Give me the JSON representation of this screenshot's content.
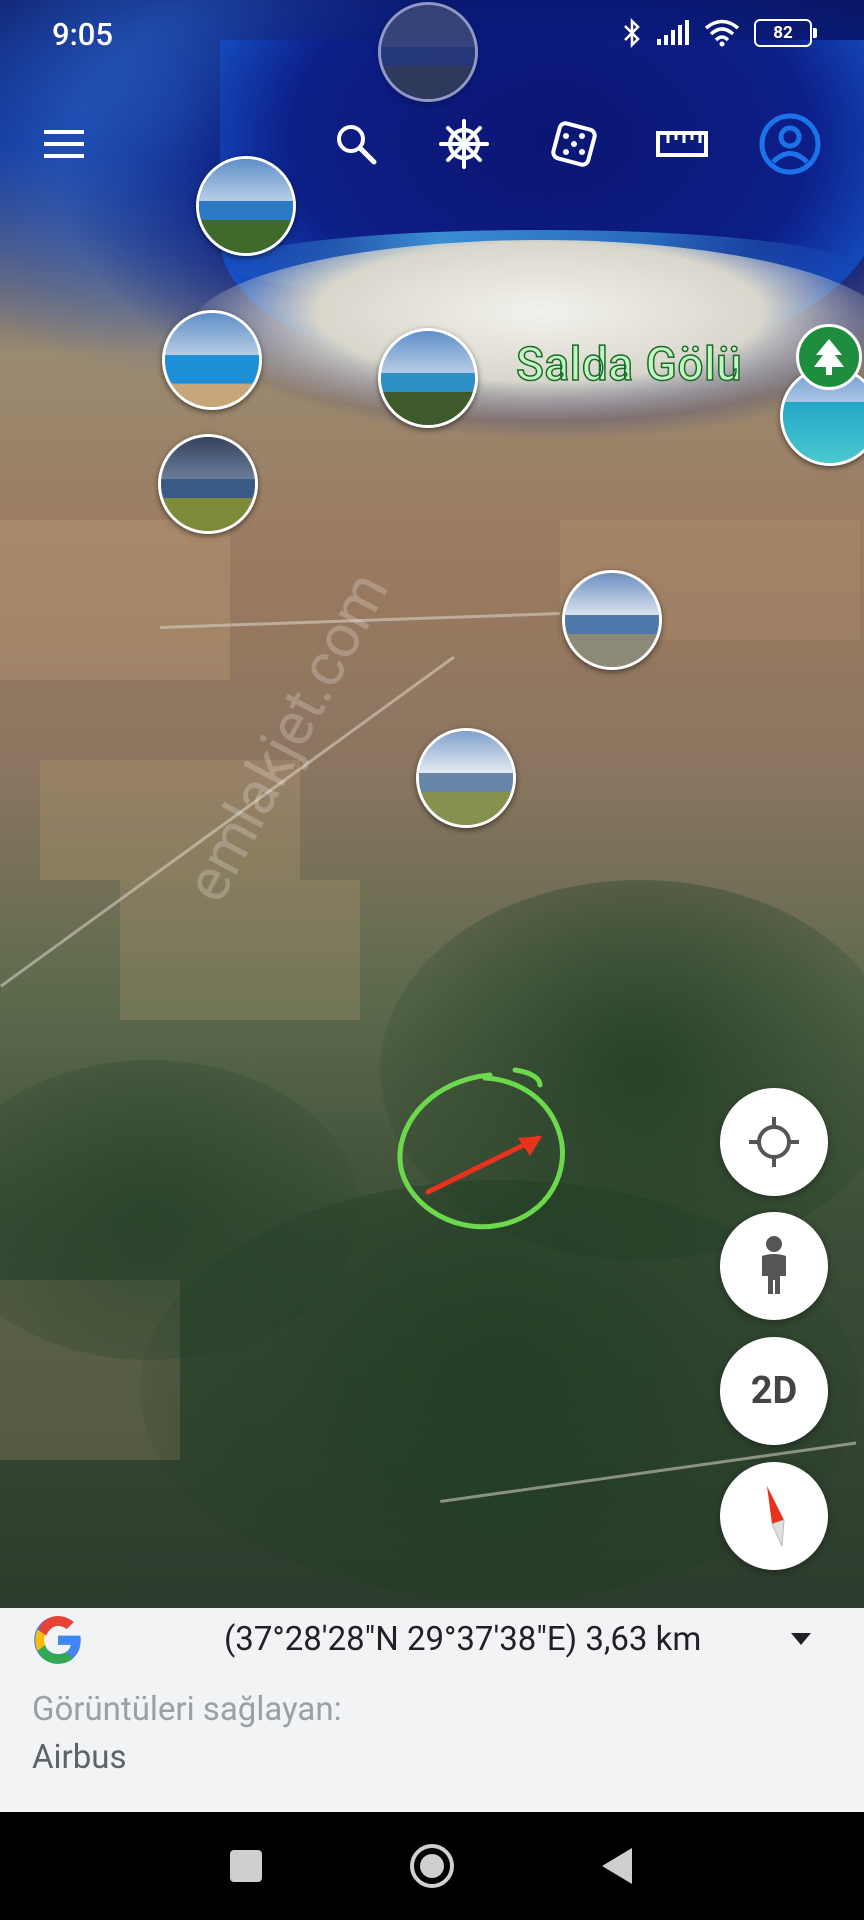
{
  "status_bar": {
    "time": "9:05",
    "battery": "82",
    "icons": [
      "bluetooth-icon",
      "signal-icon",
      "wifi-icon",
      "battery-icon"
    ]
  },
  "toolbar": {
    "items": [
      "menu-icon",
      "search-icon",
      "voyager-helm-icon",
      "dice-feeling-lucky-icon",
      "measure-ruler-icon",
      "account-icon"
    ]
  },
  "map": {
    "place_label": "Salda Gölü",
    "watermark": "emlakjet.com",
    "colors": {
      "water": "#0c1e87",
      "label_fill": "#c6f5c4",
      "marker_circle": "#6cd84c",
      "arrow": "#e8321c"
    }
  },
  "controls": {
    "view_mode_label": "2D",
    "buttons": [
      "my-location-icon",
      "street-view-pegman-icon",
      "2D",
      "compass-icon"
    ]
  },
  "info_panel": {
    "coordinates": "(37°28'28\"N 29°37'38\"E) 3,63 km",
    "imagery_label": "Görüntüleri sağlayan:",
    "imagery_provider": "Airbus"
  },
  "nav_bar": {
    "buttons": [
      "recents-square-icon",
      "home-circle-icon",
      "back-triangle-icon"
    ]
  },
  "accent": {
    "google_blue": "#1a73e8",
    "google_red": "#ea4335",
    "google_yellow": "#fbbc04",
    "google_green": "#34a853"
  }
}
